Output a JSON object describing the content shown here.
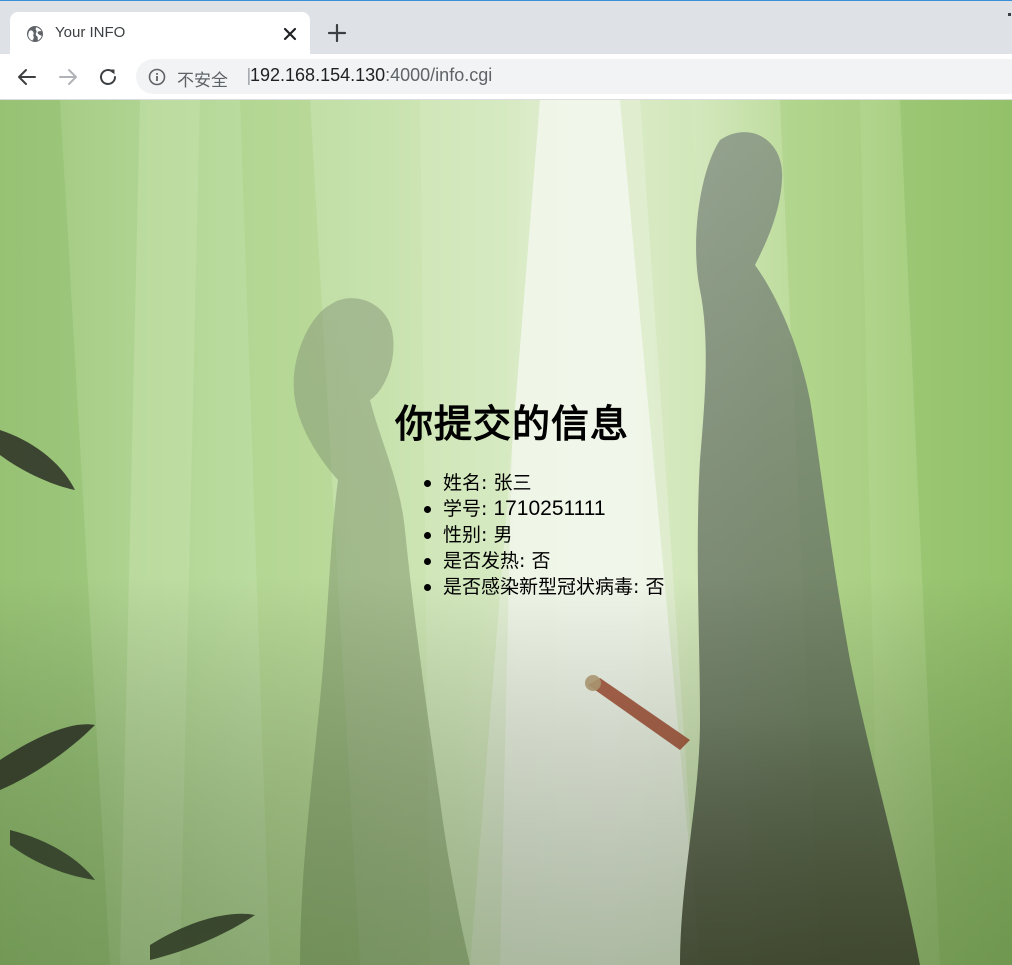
{
  "browser": {
    "tab": {
      "title": "Your INFO",
      "close_icon": "close-icon",
      "favicon": "globe-icon"
    },
    "new_tab_icon": "plus-icon",
    "nav": {
      "back_icon": "arrow-left-icon",
      "forward_icon": "arrow-right-icon",
      "reload_icon": "reload-icon"
    },
    "omnibox": {
      "security_label": "不安全",
      "separator": "|",
      "url_host": "192.168.154.130",
      "url_rest": ":4000/info.cgi"
    }
  },
  "page": {
    "heading": "你提交的信息",
    "items": [
      {
        "label": "姓名:",
        "value": "张三"
      },
      {
        "label": "学号:",
        "value": "1710251111"
      },
      {
        "label": "性别:",
        "value": "男"
      },
      {
        "label": "是否发热:",
        "value": "否"
      },
      {
        "label": "是否感染新型冠状病毒:",
        "value": "否"
      }
    ]
  },
  "colors": {
    "tabstrip": "#dee1e6",
    "omnibox": "#f1f3f4",
    "text_primary": "#202124",
    "text_secondary": "#5f6368",
    "background_green": "#a8cf85"
  }
}
